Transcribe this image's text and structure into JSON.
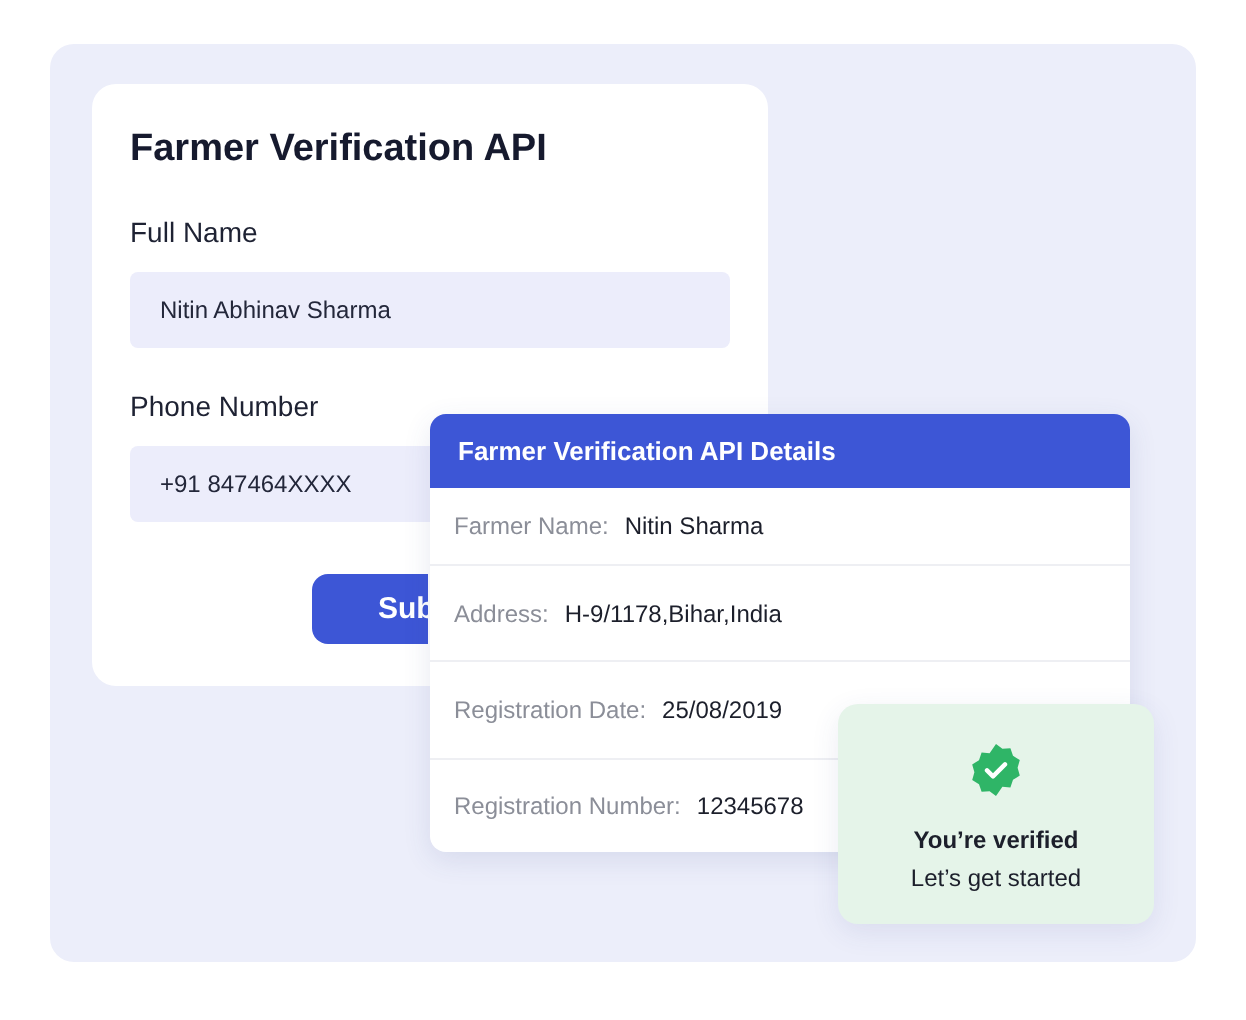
{
  "form": {
    "title": "Farmer Verification API",
    "fields": [
      {
        "label": "Full Name",
        "value": "Nitin Abhinav Sharma"
      },
      {
        "label": "Phone Number",
        "value": "+91 847464XXXX"
      }
    ],
    "submit": "Sub"
  },
  "details": {
    "title": "Farmer Verification API Details",
    "rows": [
      {
        "label": "Farmer Name:",
        "value": "Nitin Sharma"
      },
      {
        "label": "Address:",
        "value": "H-9/1178,Bihar,India"
      },
      {
        "label": "Registration Date:",
        "value": "25/08/2019"
      },
      {
        "label": "Registration Number:",
        "value": "12345678"
      }
    ]
  },
  "toast": {
    "title": "You’re verified",
    "subtitle": "Let’s get started"
  }
}
